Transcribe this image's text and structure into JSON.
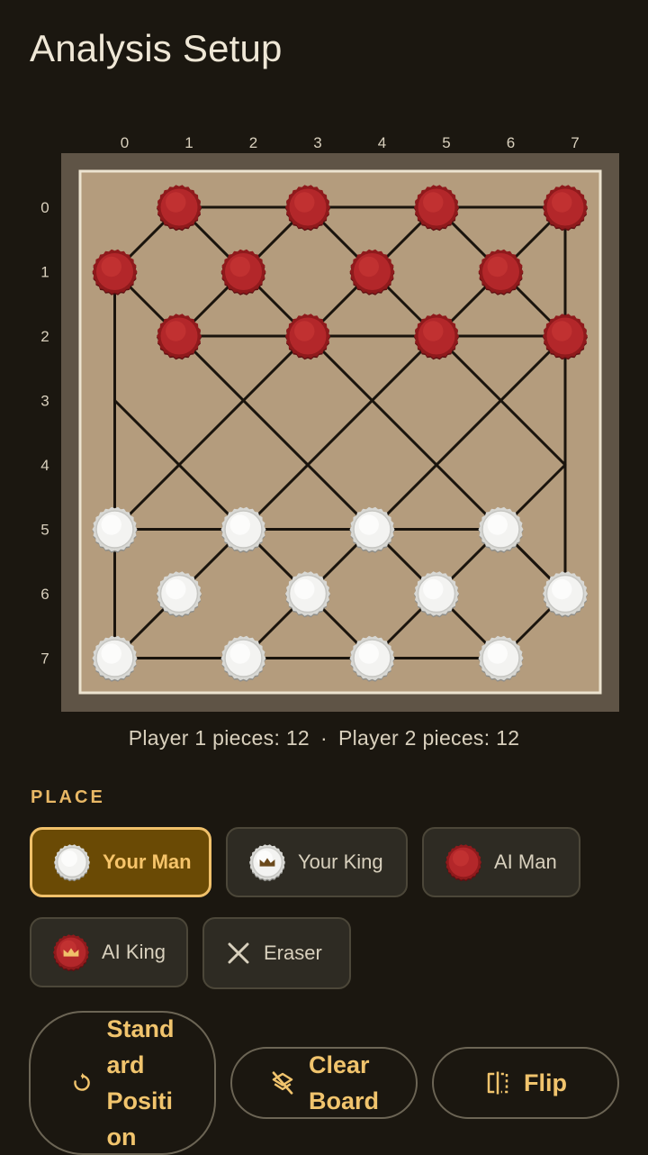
{
  "title": "Analysis Setup",
  "board": {
    "columns": [
      "0",
      "1",
      "2",
      "3",
      "4",
      "5",
      "6",
      "7"
    ],
    "rows": [
      "0",
      "1",
      "2",
      "3",
      "4",
      "5",
      "6",
      "7"
    ],
    "pieces": [
      {
        "row": 0,
        "col": 1,
        "type": "ai-man"
      },
      {
        "row": 0,
        "col": 3,
        "type": "ai-man"
      },
      {
        "row": 0,
        "col": 5,
        "type": "ai-man"
      },
      {
        "row": 0,
        "col": 7,
        "type": "ai-man"
      },
      {
        "row": 1,
        "col": 0,
        "type": "ai-man"
      },
      {
        "row": 1,
        "col": 2,
        "type": "ai-man"
      },
      {
        "row": 1,
        "col": 4,
        "type": "ai-man"
      },
      {
        "row": 1,
        "col": 6,
        "type": "ai-man"
      },
      {
        "row": 2,
        "col": 1,
        "type": "ai-man"
      },
      {
        "row": 2,
        "col": 3,
        "type": "ai-man"
      },
      {
        "row": 2,
        "col": 5,
        "type": "ai-man"
      },
      {
        "row": 2,
        "col": 7,
        "type": "ai-man"
      },
      {
        "row": 5,
        "col": 0,
        "type": "your-man"
      },
      {
        "row": 5,
        "col": 2,
        "type": "your-man"
      },
      {
        "row": 5,
        "col": 4,
        "type": "your-man"
      },
      {
        "row": 5,
        "col": 6,
        "type": "your-man"
      },
      {
        "row": 6,
        "col": 1,
        "type": "your-man"
      },
      {
        "row": 6,
        "col": 3,
        "type": "your-man"
      },
      {
        "row": 6,
        "col": 5,
        "type": "your-man"
      },
      {
        "row": 6,
        "col": 7,
        "type": "your-man"
      },
      {
        "row": 7,
        "col": 0,
        "type": "your-man"
      },
      {
        "row": 7,
        "col": 2,
        "type": "your-man"
      },
      {
        "row": 7,
        "col": 4,
        "type": "your-man"
      },
      {
        "row": 7,
        "col": 6,
        "type": "your-man"
      }
    ],
    "colors": {
      "frame": "#5f5446",
      "surface": "#b49c7d",
      "inner_border": "#ece3d0",
      "line": "#1a140d",
      "red_piece": "#b3272a",
      "white_piece": "#f3f3f1"
    }
  },
  "counts": {
    "player1": "Player 1 pieces: 12",
    "separator": "·",
    "player2": "Player 2 pieces: 12"
  },
  "place": {
    "label": "PLACE",
    "options": [
      {
        "label": "Your Man",
        "icon": "white-man-icon",
        "selected": true
      },
      {
        "label": "Your King",
        "icon": "white-king-icon",
        "selected": false
      },
      {
        "label": "AI Man",
        "icon": "red-man-icon",
        "selected": false
      },
      {
        "label": "AI King",
        "icon": "red-king-icon",
        "selected": false
      },
      {
        "label": "Eraser",
        "icon": "close-icon",
        "selected": false
      }
    ]
  },
  "actions": {
    "standard_lines": [
      "Stand",
      "ard",
      "Positi",
      "on"
    ],
    "clear_lines": [
      "Clear",
      "Board"
    ],
    "flip": "Flip",
    "icons": {
      "standard": "refresh-icon",
      "clear": "clear-layers-icon",
      "flip": "flip-icon"
    }
  },
  "accent": "#f0c06a"
}
